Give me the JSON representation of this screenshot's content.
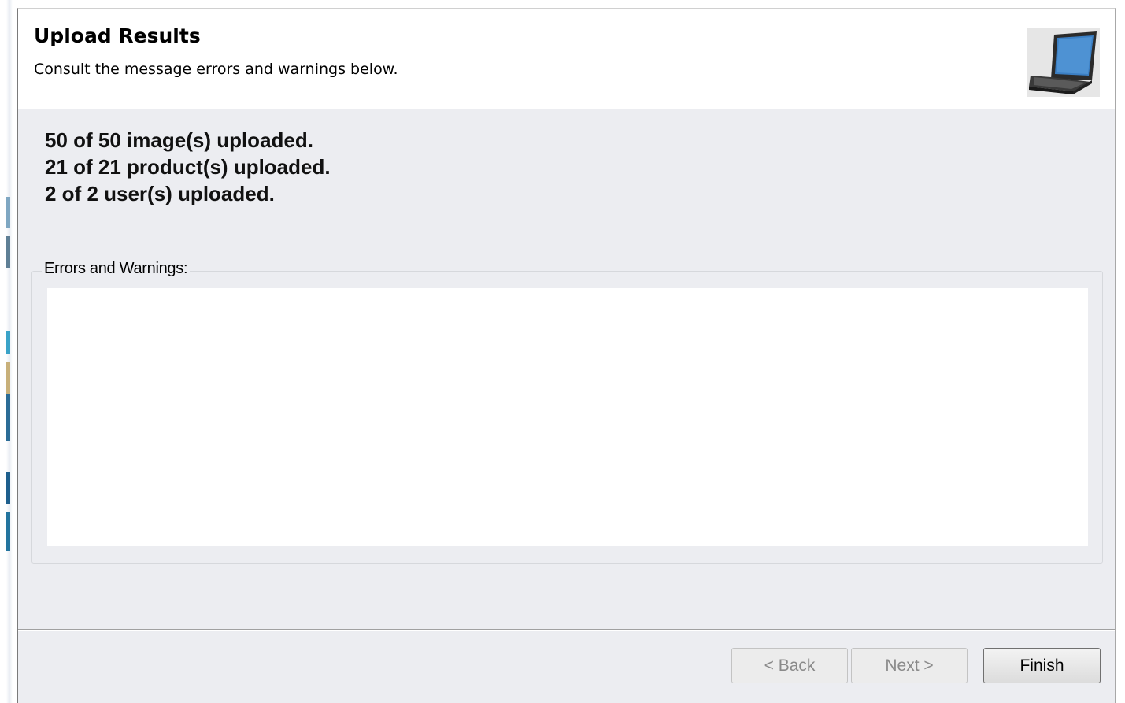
{
  "header": {
    "title": "Upload Results",
    "subtitle": "Consult the message errors and warnings below.",
    "icon": "laptop-icon"
  },
  "summary": {
    "lines": [
      "50 of 50 image(s) uploaded.",
      "21 of 21 product(s) uploaded.",
      "2 of 2 user(s) uploaded."
    ]
  },
  "errors_group": {
    "label": "Errors and Warnings:",
    "content": ""
  },
  "buttons": {
    "back": {
      "label": "< Back",
      "enabled": false
    },
    "next": {
      "label": "Next >",
      "enabled": false
    },
    "finish": {
      "label": "Finish",
      "enabled": true
    }
  }
}
